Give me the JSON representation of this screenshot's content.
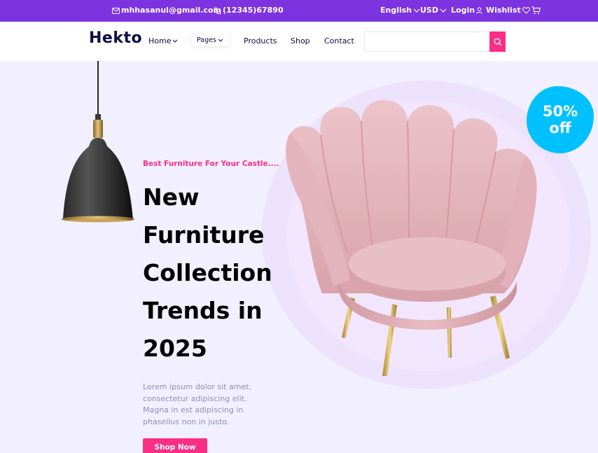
{
  "topbar": {
    "email": "mhhasanul@gmail.com",
    "phone": "(12345)67890",
    "language": "English",
    "currency": "USD",
    "login": "Login",
    "wishlist": "Wishlist",
    "icons": [
      "mail-icon",
      "phone-icon",
      "chevron-down-icon",
      "user-icon",
      "heart-icon",
      "cart-icon"
    ]
  },
  "nav": {
    "logo": "Hekto",
    "links": {
      "home": "Home",
      "pages": "Pages",
      "products": "Products",
      "shop": "Shop",
      "contact": "Contact"
    },
    "search": {
      "placeholder": "",
      "value": ""
    }
  },
  "hero": {
    "subtitle": "Best Furniture For Your Castle....",
    "headline": "New Furniture Collection Trends in 2025",
    "description": "Lorem ipsum dolor sit amet, consectetur adipiscing elit. Magna in est adipiscing in phasellus non in justo.",
    "cta": "Shop Now",
    "badge": {
      "line1": "50%",
      "line2": "off"
    }
  },
  "colors": {
    "topbar": "#7e33e0",
    "accent": "#fb2e86",
    "navy": "#0d0e43",
    "hero_bg": "#f2f0ff",
    "badge": "#00c1fe",
    "body_text": "#8a8fb9"
  }
}
